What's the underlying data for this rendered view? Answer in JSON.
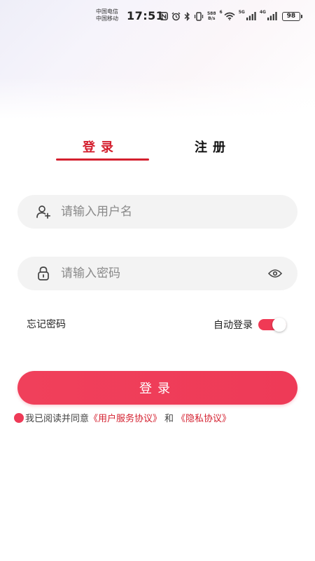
{
  "status_bar": {
    "carrier_1": "中国电信",
    "carrier_2": "中国移动",
    "time": "17:51",
    "net_speed_value": "588",
    "net_speed_unit": "B/s",
    "wifi_label": "6",
    "sim1_label": "5G",
    "sim2_label": "4G",
    "battery": "98"
  },
  "tabs": {
    "login": "登录",
    "register": "注册",
    "active": "login"
  },
  "form": {
    "username_placeholder": "请输入用户名",
    "username_value": "",
    "password_placeholder": "请输入密码",
    "password_value": "",
    "forgot_password": "忘记密码",
    "auto_login_label": "自动登录",
    "auto_login_enabled": true,
    "login_button": "登录"
  },
  "agreement": {
    "prefix": "我已阅读并同意",
    "user_agreement": "《用户服务协议》",
    "and": "和",
    "privacy_policy": "《隐私协议》"
  },
  "colors": {
    "accent": "#d4202f",
    "button": "#f0405b",
    "input_bg": "#f3f3f3"
  }
}
